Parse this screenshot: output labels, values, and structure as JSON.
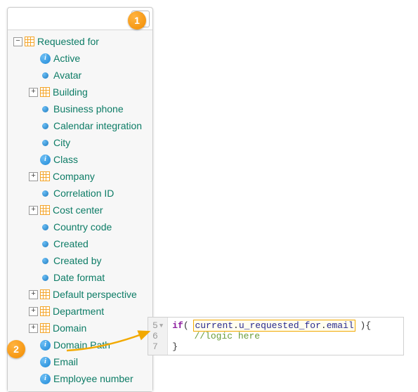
{
  "badges": {
    "one": "1",
    "two": "2"
  },
  "tree": {
    "root": {
      "label": "Requested for"
    },
    "items": [
      {
        "label": "Active",
        "icon": "info",
        "expand": null
      },
      {
        "label": "Avatar",
        "icon": "dot",
        "expand": null
      },
      {
        "label": "Building",
        "icon": "table",
        "expand": "+"
      },
      {
        "label": "Business phone",
        "icon": "dot",
        "expand": null
      },
      {
        "label": "Calendar integration",
        "icon": "dot",
        "expand": null
      },
      {
        "label": "City",
        "icon": "dot",
        "expand": null
      },
      {
        "label": "Class",
        "icon": "info",
        "expand": null
      },
      {
        "label": "Company",
        "icon": "table",
        "expand": "+"
      },
      {
        "label": "Correlation ID",
        "icon": "dot",
        "expand": null
      },
      {
        "label": "Cost center",
        "icon": "table",
        "expand": "+"
      },
      {
        "label": "Country code",
        "icon": "dot",
        "expand": null
      },
      {
        "label": "Created",
        "icon": "dot",
        "expand": null
      },
      {
        "label": "Created by",
        "icon": "dot",
        "expand": null
      },
      {
        "label": "Date format",
        "icon": "dot",
        "expand": null
      },
      {
        "label": "Default perspective",
        "icon": "table",
        "expand": "+"
      },
      {
        "label": "Department",
        "icon": "table",
        "expand": "+"
      },
      {
        "label": "Domain",
        "icon": "table",
        "expand": "+"
      },
      {
        "label": "Domain Path",
        "icon": "info",
        "expand": null
      },
      {
        "label": "Email",
        "icon": "info",
        "expand": null
      },
      {
        "label": "Employee number",
        "icon": "info",
        "expand": null
      }
    ]
  },
  "code": {
    "lineStart": 5,
    "kw_if": "if",
    "paren_open": "( ",
    "hl_current": "current",
    "hl_dot1": ".",
    "hl_req": "u_requested_for",
    "hl_dot2": ".",
    "hl_email": "email",
    "after_hl": " ){",
    "comment": "//logic here",
    "close": "}",
    "ln5": "5",
    "ln6": "6",
    "ln7": "7"
  }
}
